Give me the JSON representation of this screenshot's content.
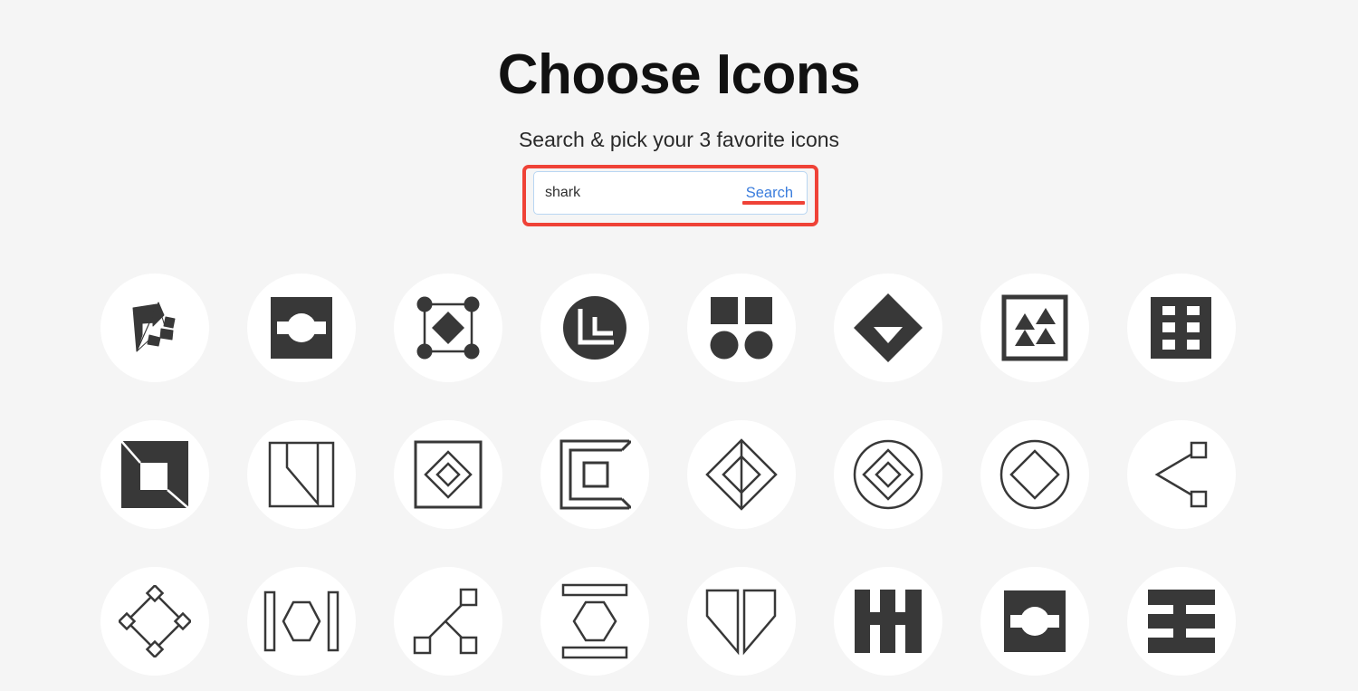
{
  "header": {
    "title": "Choose Icons",
    "subtitle": "Search & pick your 3 favorite icons"
  },
  "search": {
    "value": "shark",
    "placeholder": "",
    "submit_label": "Search",
    "accent_color": "#3b7ddd",
    "highlight_color": "#ef4237",
    "border_color": "#b9d6f2"
  },
  "theme": {
    "background": "#f5f5f5",
    "disc_color": "#ffffff",
    "icon_color": "#383838",
    "title_color": "#111111"
  },
  "grid": {
    "columns": 8,
    "rows": 3,
    "count": 24,
    "icons": [
      {
        "id": 1,
        "name": "faceted-origami-arrow-icon"
      },
      {
        "id": 2,
        "name": "square-circle-band-cutout-icon"
      },
      {
        "id": 3,
        "name": "diamond-in-dotted-square-icon"
      },
      {
        "id": 4,
        "name": "circle-nested-corner-brackets-icon"
      },
      {
        "id": 5,
        "name": "two-squares-two-circles-icon"
      },
      {
        "id": 6,
        "name": "diamond-triangle-notch-icon"
      },
      {
        "id": 7,
        "name": "square-four-triangles-icon"
      },
      {
        "id": 8,
        "name": "ladder-grid-bars-icon"
      },
      {
        "id": 9,
        "name": "filled-square-inner-square-icon"
      },
      {
        "id": 10,
        "name": "square-diagonal-fold-icon"
      },
      {
        "id": 11,
        "name": "square-nested-diamonds-icon"
      },
      {
        "id": 12,
        "name": "nested-bracket-square-icon"
      },
      {
        "id": 13,
        "name": "nested-diamonds-centerline-icon"
      },
      {
        "id": 14,
        "name": "circle-nested-diamonds-icon"
      },
      {
        "id": 15,
        "name": "circle-diamond-icon"
      },
      {
        "id": 16,
        "name": "angle-bracket-nodes-icon"
      },
      {
        "id": 17,
        "name": "diamond-node-vertices-icon"
      },
      {
        "id": 18,
        "name": "hexagon-between-bars-icon"
      },
      {
        "id": 19,
        "name": "tree-three-nodes-icon"
      },
      {
        "id": 20,
        "name": "hexagon-stacked-bars-icon"
      },
      {
        "id": 21,
        "name": "twin-pointed-shields-icon"
      },
      {
        "id": 22,
        "name": "triple-vertical-bars-icon"
      },
      {
        "id": 23,
        "name": "square-circle-band-cutout-icon-2"
      },
      {
        "id": 24,
        "name": "triple-horizontal-bars-icon"
      }
    ]
  }
}
